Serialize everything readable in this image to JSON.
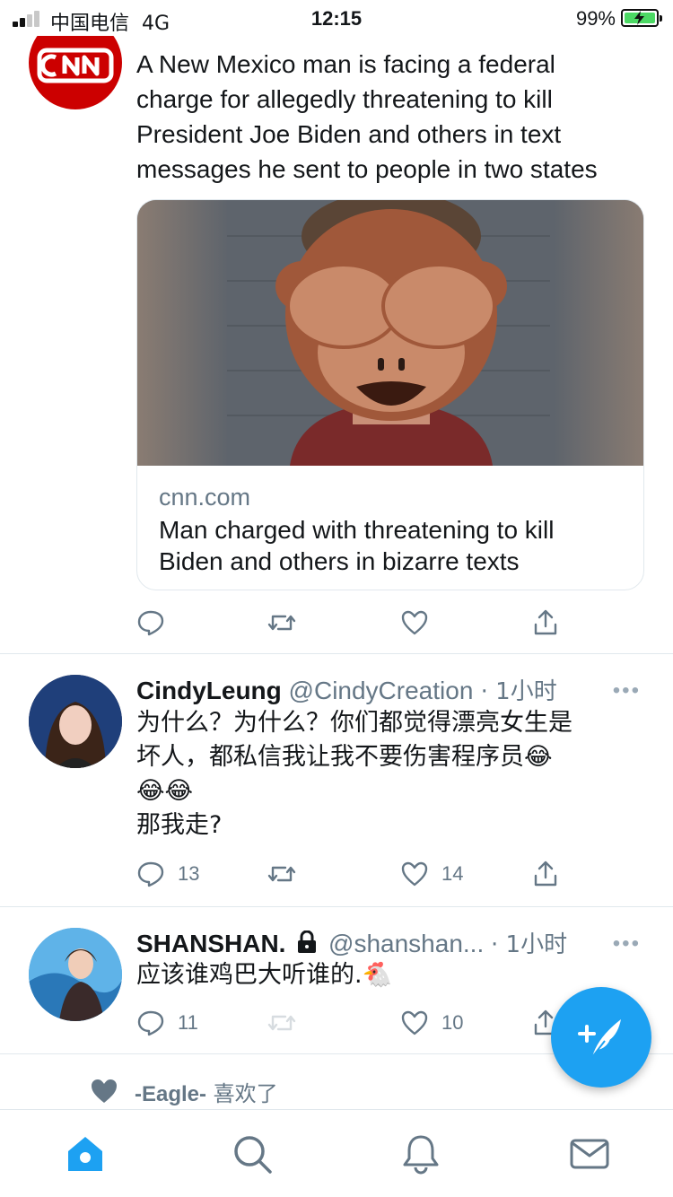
{
  "status_bar": {
    "carrier": "中国电信",
    "network": "4G",
    "time": "12:15",
    "battery": "99%"
  },
  "tweets": [
    {
      "avatar": "cnn-logo",
      "text_lines": [
        "A New Mexico man is facing a federal",
        "charge for allegedly threatening to kill",
        "President Joe Biden and others in text",
        "messages he sent to people in two states"
      ],
      "card": {
        "image": "mugshot-with-see-no-evil-monkey-emoji",
        "domain": "cnn.com",
        "title_lines": [
          "Man charged with threatening to kill",
          "Biden and others in bizarre texts"
        ]
      },
      "counts": {
        "reply": "",
        "retweet": "",
        "like": ""
      }
    },
    {
      "name": "CindyLeung",
      "handle": "@CindyCreation",
      "time": " · 1小时",
      "text_lines": [
        "为什么？为什么？你们都觉得漂亮女生是",
        "坏人，都私信我让我不要伤害程序员😂",
        "😂😂",
        "那我走?"
      ],
      "counts": {
        "reply": "13",
        "retweet": "",
        "like": "14"
      }
    },
    {
      "name": "SHANSHAN.",
      "handle": "@shanshan...",
      "time": " · 1小时",
      "text_lines": [
        "应该谁鸡巴大听谁的.🐔"
      ],
      "counts": {
        "reply": "11",
        "retweet": "",
        "like": "10"
      }
    }
  ],
  "liked_row": {
    "user": "-Eagle-",
    "action": " 喜欢了"
  },
  "more_glyph": "•••",
  "colors": {
    "accent": "#1da1f2",
    "secondary_text": "#657786",
    "divider": "#e1e8ed",
    "cnn_red": "#cc0000"
  },
  "icons": [
    "reply-icon",
    "retweet-icon",
    "like-icon",
    "share-icon",
    "home-icon",
    "search-icon",
    "notifications-icon",
    "messages-icon",
    "compose-icon",
    "lock-icon",
    "heart-filled-icon"
  ]
}
